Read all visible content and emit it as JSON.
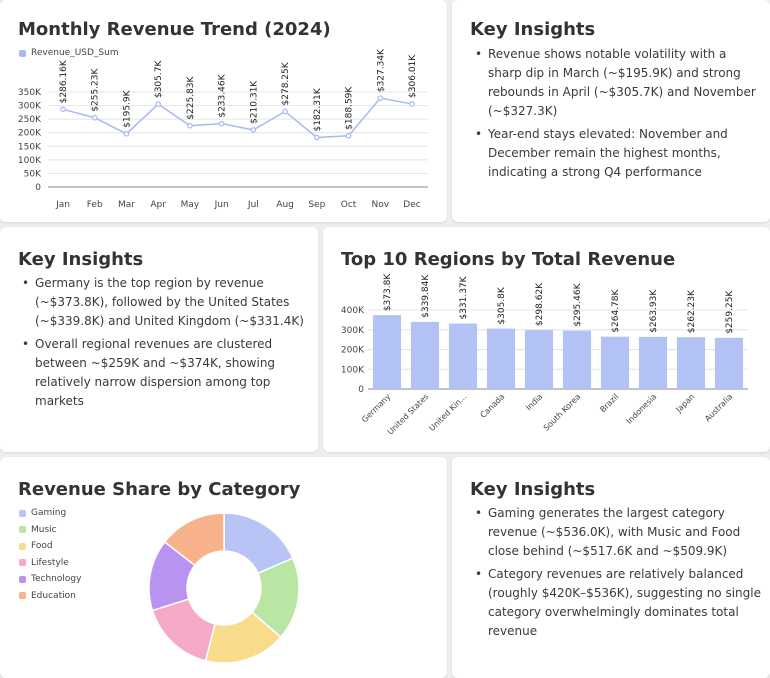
{
  "line_card": {
    "title": "Monthly Revenue Trend (2024)",
    "legend_label": "Revenue_USD_Sum"
  },
  "insights_1": {
    "title": "Key Insights",
    "bullets": [
      "Revenue shows notable volatility with a sharp dip in March (~$195.9K) and strong rebounds in April (~$305.7K) and November (~$327.3K)",
      "Year-end stays elevated: November and December remain the highest months, indicating a strong Q4 performance"
    ]
  },
  "insights_2": {
    "title": "Key Insights",
    "bullets": [
      "Germany is the top region by revenue (~$373.8K), followed by the United States (~$339.8K) and United Kingdom (~$331.4K)",
      "Overall regional revenues are clustered between ~$259K and ~$374K, showing relatively narrow dispersion among top markets"
    ]
  },
  "bar_card": {
    "title": "Top 10 Regions by Total Revenue"
  },
  "pie_card": {
    "title": "Revenue Share by Category"
  },
  "insights_3": {
    "title": "Key Insights",
    "bullets": [
      "Gaming generates the largest category revenue (~$536.0K), with Music and Food close behind (~$517.6K and ~$509.9K)",
      "Category revenues are relatively balanced (roughly $420K–$536K), suggesting no single category overwhelmingly dominates total revenue"
    ]
  },
  "chart_data": [
    {
      "type": "line",
      "title": "Monthly Revenue Trend (2024)",
      "x": [
        "Jan",
        "Feb",
        "Mar",
        "Apr",
        "May",
        "Jun",
        "Jul",
        "Aug",
        "Sep",
        "Oct",
        "Nov",
        "Dec"
      ],
      "series": [
        {
          "name": "Revenue_USD_Sum",
          "values": [
            286160,
            255230,
            195900,
            305700,
            225830,
            233460,
            210310,
            278250,
            182310,
            188590,
            327340,
            306010
          ],
          "labels": [
            "$286.16K",
            "$255.23K",
            "$195.9K",
            "$305.7K",
            "$225.83K",
            "$233.46K",
            "$210.31K",
            "$278.25K",
            "$182.31K",
            "$188.59K",
            "$327.34K",
            "$306.01K"
          ],
          "color": "#a9b8ef"
        }
      ],
      "yticks": [
        0,
        50000,
        100000,
        150000,
        200000,
        250000,
        300000,
        350000
      ],
      "ytick_labels": [
        "0",
        "50K",
        "100K",
        "150K",
        "200K",
        "250K",
        "300K",
        "350K"
      ],
      "ylim": [
        0,
        350000
      ],
      "grid": true,
      "legend": "top-left"
    },
    {
      "type": "bar",
      "title": "Top 10 Regions by Total Revenue",
      "categories": [
        "Germany",
        "United States",
        "United Kin...",
        "Canada",
        "India",
        "South Korea",
        "Brazil",
        "Indonesia",
        "Japan",
        "Australia"
      ],
      "values": [
        373800,
        339840,
        331370,
        305800,
        298620,
        295460,
        264780,
        263930,
        262230,
        259250
      ],
      "labels": [
        "$373.8K",
        "$339.84K",
        "$331.37K",
        "$305.8K",
        "$298.62K",
        "$295.46K",
        "$264.78K",
        "$263.93K",
        "$262.23K",
        "$259.25K"
      ],
      "yticks": [
        0,
        100000,
        200000,
        300000,
        400000
      ],
      "ytick_labels": [
        "0",
        "100K",
        "200K",
        "300K",
        "400K"
      ],
      "ylim": [
        0,
        400000
      ],
      "color": "#b3c2f5",
      "grid": true
    },
    {
      "type": "pie",
      "title": "Revenue Share by Category",
      "donut": true,
      "categories": [
        "Gaming",
        "Music",
        "Food",
        "Lifestyle",
        "Technology",
        "Education"
      ],
      "values": [
        536000,
        517600,
        509900,
        470000,
        445000,
        420000
      ],
      "colors": [
        "#b8c4f5",
        "#b9e6a3",
        "#f8dc8c",
        "#f6a9c6",
        "#b893ef",
        "#f7b28c"
      ],
      "legend": "left"
    }
  ]
}
